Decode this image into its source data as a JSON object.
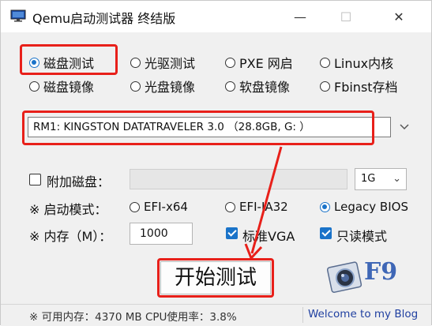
{
  "window": {
    "title": "Qemu启动测试器 终结版",
    "controls": {
      "minimize": "—",
      "maximize": "☐",
      "close": "✕"
    }
  },
  "modes": {
    "row1": [
      "磁盘测试",
      "光驱测试",
      "PXE 网启",
      "Linux内核"
    ],
    "row2": [
      "磁盘镜像",
      "光盘镜像",
      "软盘镜像",
      "Fbinst存档"
    ],
    "selected": "磁盘测试"
  },
  "disk_select": {
    "value": "RM1: KINGSTON DATATRAVELER 3.0 （28.8GB, G: ）"
  },
  "extra_disk": {
    "label": "附加磁盘：",
    "checked": false,
    "size": "1G"
  },
  "boot_mode": {
    "label": "※ 启动模式：",
    "options": [
      "EFI-x64",
      "EFI-IA32",
      "Legacy BIOS"
    ],
    "selected": "Legacy BIOS"
  },
  "memory": {
    "label": "※ 内存（M）：",
    "value": "1000"
  },
  "options": {
    "standard_vga": {
      "label": "标准VGA",
      "checked": true
    },
    "readonly": {
      "label": "只读模式",
      "checked": true
    }
  },
  "start_button": "开始测试",
  "logo_text": "F9",
  "status": {
    "info": "※ 可用内存：4370 MB  CPU使用率：3.8%",
    "link": "Welcome to my Blog"
  },
  "colors": {
    "highlight_red": "#e8201a",
    "accent_blue": "#1a73c9",
    "link_blue": "#1f3fa0"
  }
}
